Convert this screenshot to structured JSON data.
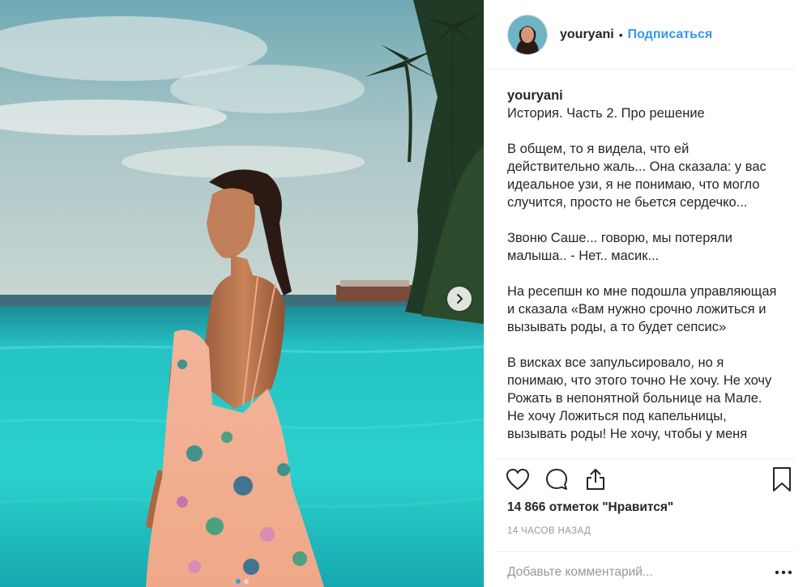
{
  "post": {
    "username": "youryani",
    "separator": "•",
    "follow_label": "Подписаться",
    "caption_user": "youryani",
    "caption_paragraphs": [
      "История. Часть 2. Про решение",
      "В общем, то я видела, что ей действительно жаль... Она сказала: у вас идеальное узи, я не понимаю, что могло случится, просто не бьется сердечко...",
      "Звоню Саше... говорю, мы потеряли малыша.. - Нет.. масик...",
      "На ресепшн ко мне подошла управляющая и сказала «Вам нужно срочно ложиться и вызывать роды, а то будет сепсис»",
      "В висках все запульсировало, но я понимаю, что этого точно Не хочу. Не хочу Рожать в непонятной больнице на Мале. Не хочу Ложиться под капельницы, вызывать роды! Не хочу, чтобы у меня"
    ],
    "likes": "14 866 отметок \"Нравится\"",
    "time_ago": "14 часов назад",
    "comment_placeholder": "Добавьте комментарий...",
    "carousel": {
      "slides": 2,
      "active": 1
    }
  },
  "icons": {
    "like": "heart-icon",
    "comment": "comment-icon",
    "share": "share-icon",
    "save": "bookmark-icon",
    "next": "chevron-right-icon",
    "more": "more-dots-icon"
  },
  "colors": {
    "link": "#3897f0",
    "text": "#262626",
    "muted": "#999999",
    "border": "#efefef"
  }
}
